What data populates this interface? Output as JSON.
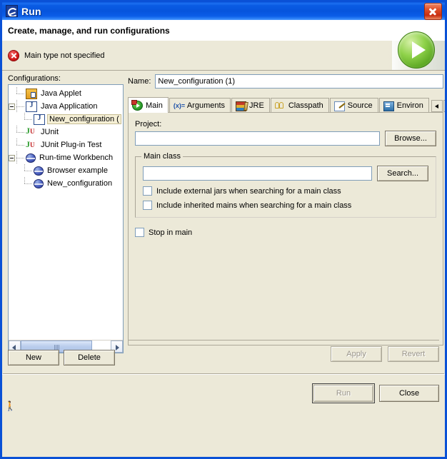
{
  "window": {
    "title": "Run",
    "icon": "eclipse-logo-icon",
    "close_icon": "close-icon"
  },
  "header": {
    "title": "Create, manage, and run configurations",
    "error_icon": "error-icon",
    "error_message": "Main type not specified",
    "run_badge_icon": "run-play-icon"
  },
  "left": {
    "label": "Configurations:",
    "tree": [
      {
        "label": "Java Applet",
        "icon": "java-applet-icon",
        "indent": 1,
        "expander": "none",
        "selected": false
      },
      {
        "label": "Java Application",
        "icon": "java-application-icon",
        "indent": 0,
        "expander": "expanded",
        "selected": false
      },
      {
        "label": "New_configuration (",
        "icon": "java-application-icon",
        "indent": 2,
        "expander": "none",
        "selected": true
      },
      {
        "label": "JUnit",
        "icon": "junit-icon",
        "indent": 1,
        "expander": "none",
        "selected": false
      },
      {
        "label": "JUnit Plug-in Test",
        "icon": "junit-plugin-test-icon",
        "indent": 1,
        "expander": "none",
        "selected": false
      },
      {
        "label": "Run-time Workbench",
        "icon": "runtime-workbench-icon",
        "indent": 0,
        "expander": "expanded",
        "selected": false
      },
      {
        "label": "Browser example",
        "icon": "runtime-workbench-icon",
        "indent": 2,
        "expander": "none",
        "selected": false
      },
      {
        "label": "New_configuration",
        "icon": "runtime-workbench-icon",
        "indent": 2,
        "expander": "none",
        "selected": false
      }
    ],
    "scrollbar": {
      "left_arrow_icon": "scroll-left-icon",
      "right_arrow_icon": "scroll-right-icon"
    },
    "new_label": "New",
    "delete_label": "Delete"
  },
  "right": {
    "name_label": "Name:",
    "name_value": "New_configuration (1)",
    "name_placeholder": "",
    "tabs": [
      {
        "label": "Main",
        "icon": "main-tab-icon",
        "active": true
      },
      {
        "label": "Arguments",
        "icon": "arguments-tab-icon",
        "active": false
      },
      {
        "label": "JRE",
        "icon": "jre-tab-icon",
        "active": false
      },
      {
        "label": "Classpath",
        "icon": "classpath-tab-icon",
        "active": false
      },
      {
        "label": "Source",
        "icon": "source-tab-icon",
        "active": false
      },
      {
        "label": "Environ",
        "icon": "environment-tab-icon",
        "active": false
      }
    ],
    "tab_nav": {
      "prev_icon": "tab-scroll-left-icon",
      "next_icon": "tab-scroll-right-icon"
    },
    "main_tab": {
      "project_label": "Project:",
      "project_value": "",
      "browse_label": "Browse...",
      "main_class_group_label": "Main class",
      "main_class_value": "",
      "search_label": "Search...",
      "include_external_jars_label": "Include external jars when searching for a main class",
      "include_external_jars_checked": false,
      "include_inherited_mains_label": "Include inherited mains when searching for a main class",
      "include_inherited_mains_checked": false,
      "stop_in_main_label": "Stop in main",
      "stop_in_main_checked": false
    },
    "apply_label": "Apply",
    "revert_label": "Revert"
  },
  "footer": {
    "run_label": "Run",
    "close_label": "Close",
    "grip_icon": "resize-grip-icon"
  }
}
